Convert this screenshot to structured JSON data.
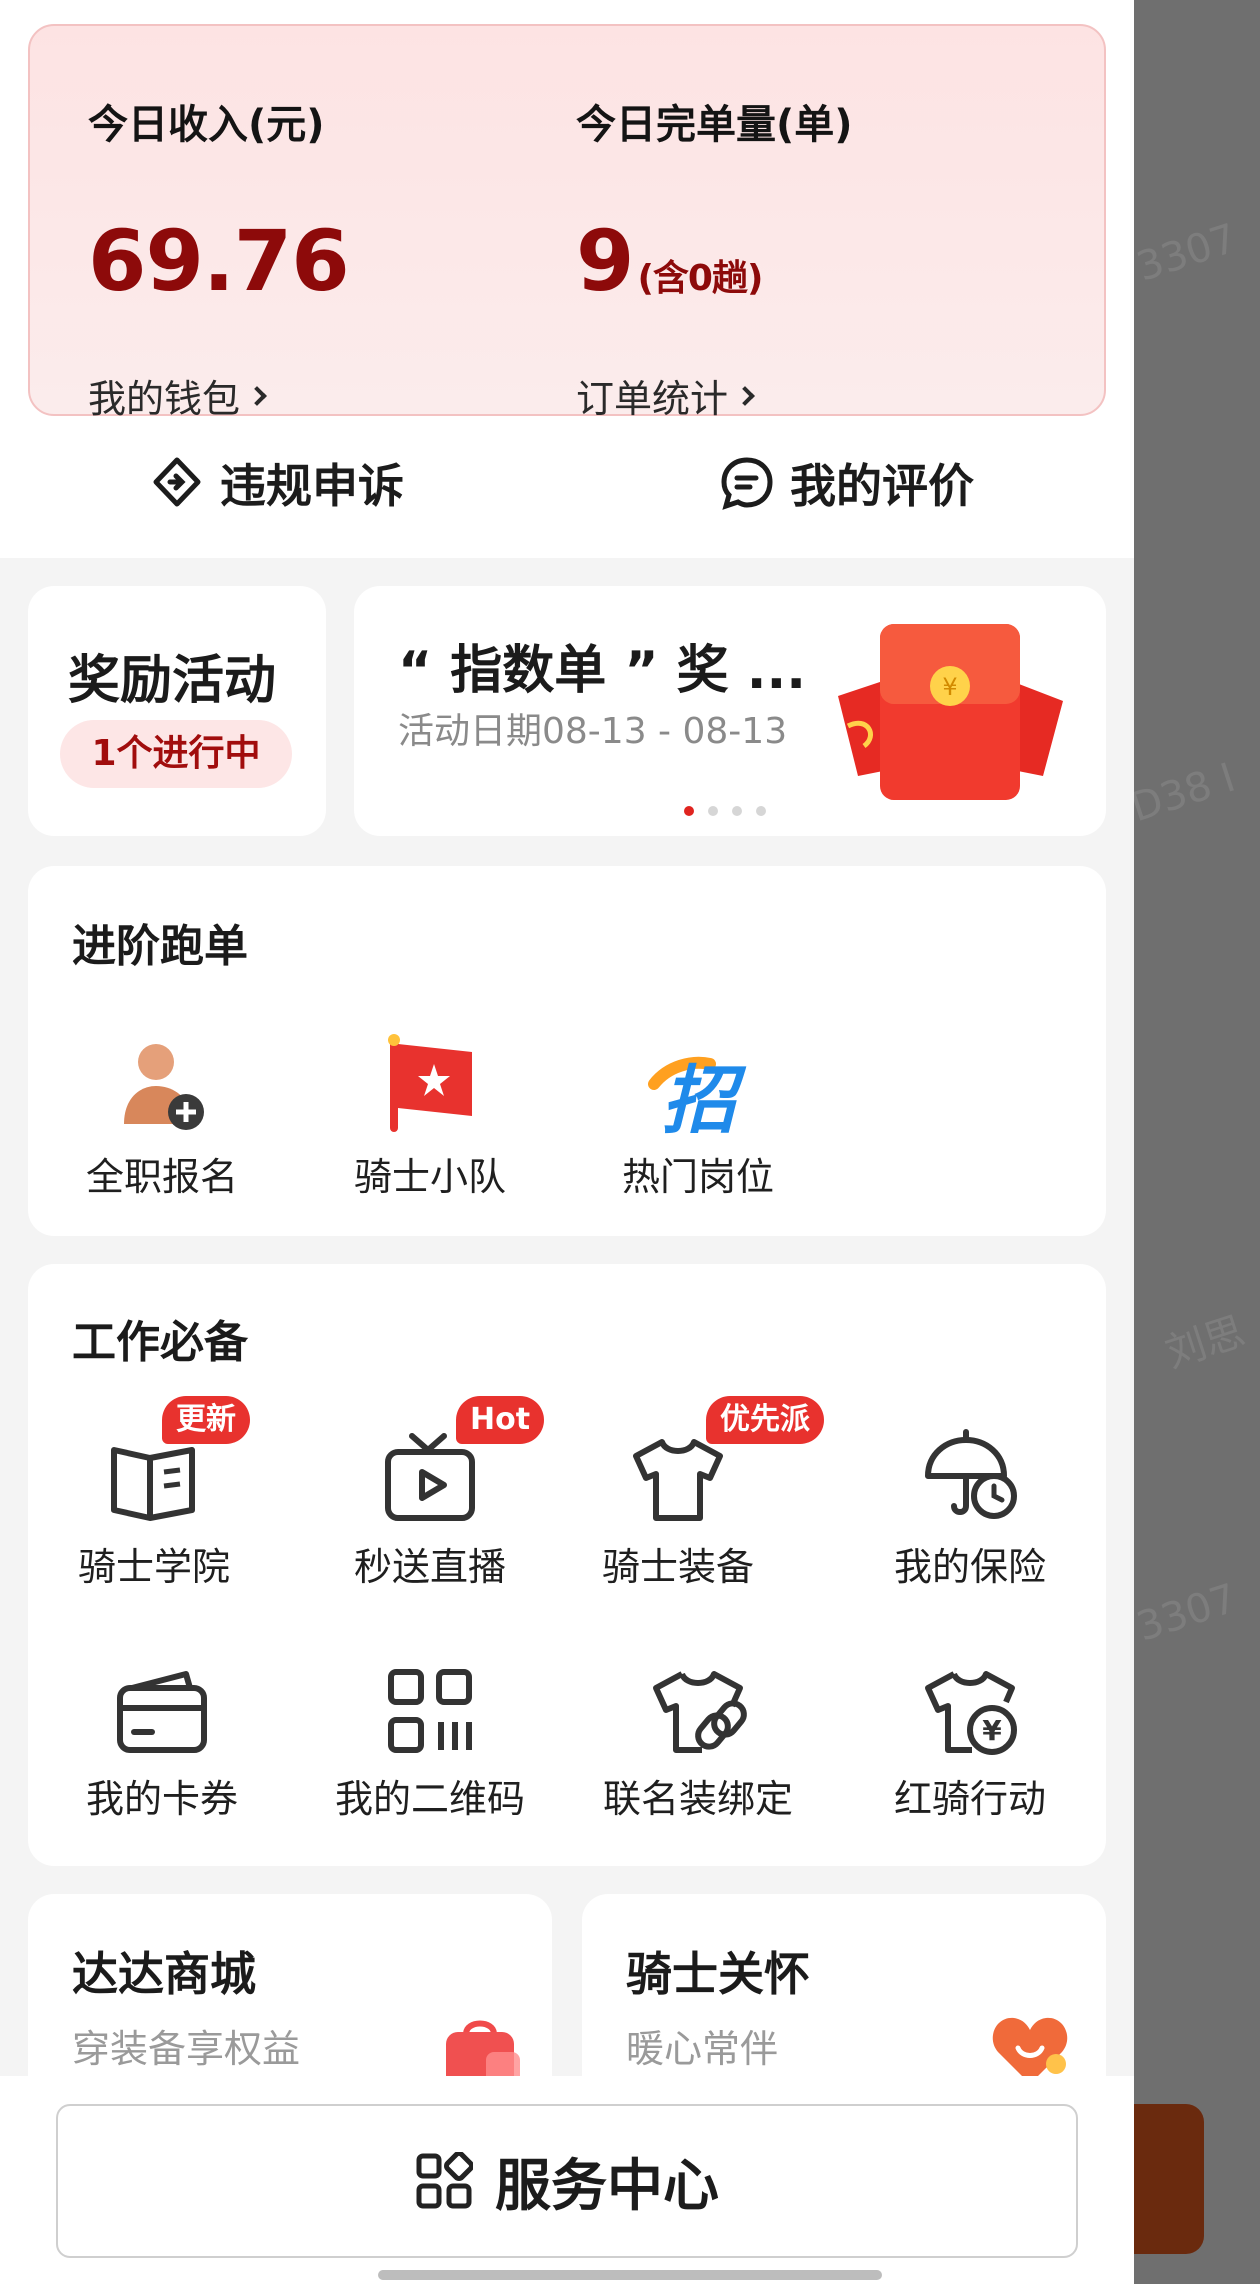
{
  "income": {
    "label": "今日收入(元)",
    "value": "69.76",
    "link": "我的钱包"
  },
  "orders": {
    "label": "今日完单量(单)",
    "value": "9",
    "suffix": "(含0趟)",
    "link": "订单统计"
  },
  "quick_actions": {
    "appeal": "违规申诉",
    "reviews": "我的评价"
  },
  "reward": {
    "title": "奖励活动",
    "badge": "1个进行中"
  },
  "banner": {
    "title": "“ 指数单 ” 奖 ...",
    "date": "活动日期08-13 - 08-13",
    "active_dot": 1,
    "dot_count": 4
  },
  "advanced": {
    "title": "进阶跑单",
    "items": [
      {
        "label": "全职报名",
        "icon": "person-add-icon"
      },
      {
        "label": "骑士小队",
        "icon": "flag-icon"
      },
      {
        "label": "热门岗位",
        "icon": "recruit-icon"
      }
    ]
  },
  "essentials": {
    "title": "工作必备",
    "items": [
      {
        "label": "骑士学院",
        "icon": "book-icon",
        "badge": "更新"
      },
      {
        "label": "秒送直播",
        "icon": "tv-play-icon",
        "badge": "Hot"
      },
      {
        "label": "骑士装备",
        "icon": "shirt-icon",
        "badge": "优先派"
      },
      {
        "label": "我的保险",
        "icon": "umbrella-clock-icon"
      },
      {
        "label": "我的卡券",
        "icon": "card-icon"
      },
      {
        "label": "我的二维码",
        "icon": "qr-code-icon"
      },
      {
        "label": "联名装绑定",
        "icon": "shirt-link-icon"
      },
      {
        "label": "红骑行动",
        "icon": "shirt-yen-icon"
      }
    ]
  },
  "mall": {
    "title": "达达商城",
    "subtitle": "穿装备享权益",
    "icon": "shopping-bag-icon"
  },
  "care": {
    "title": "骑士关怀",
    "subtitle": "暖心常伴",
    "icon": "heart-smile-icon"
  },
  "service_center": {
    "label": "服务中心"
  },
  "watermarks": [
    "3307",
    "D38 I",
    "刘思",
    "3307"
  ],
  "colors": {
    "accent_red": "#8d0a0a",
    "badge_red": "#e8322e",
    "card_pink": "#fde3e3"
  }
}
